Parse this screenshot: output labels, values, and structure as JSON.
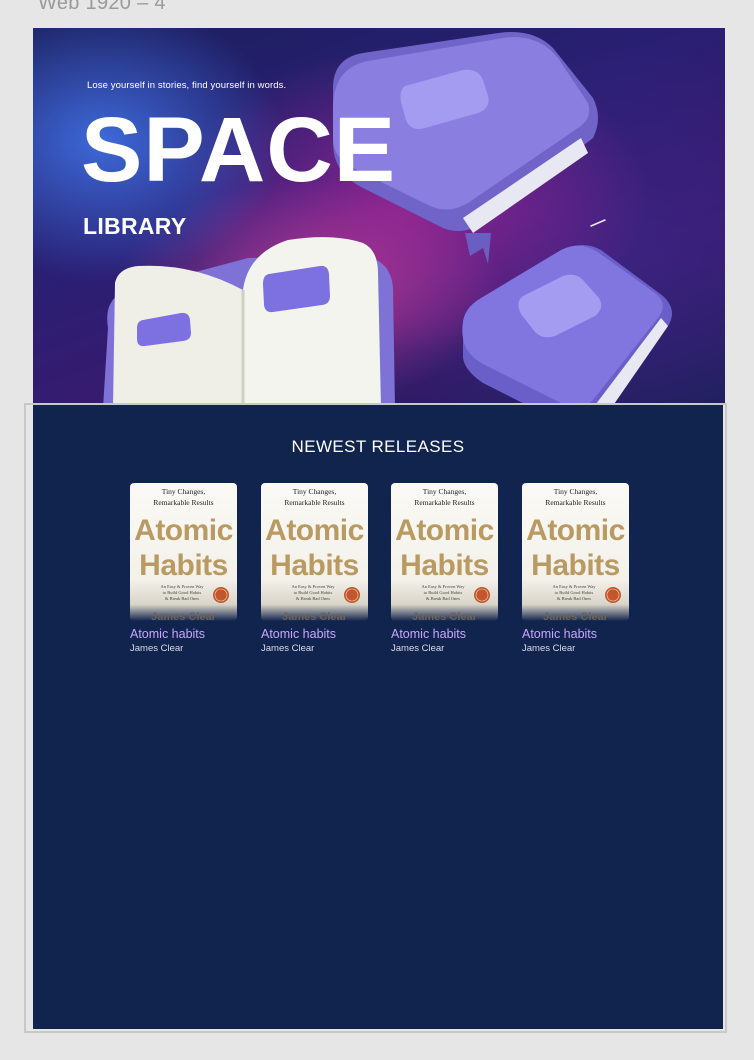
{
  "frame": {
    "label": "Web 1920 – 4"
  },
  "hero": {
    "tagline": "Lose yourself in stories, find yourself in words.",
    "title": "SPACE",
    "subtitle": "LIBRARY"
  },
  "releases": {
    "heading": "NEWEST RELEASES",
    "books": [
      {
        "title": "Atomic habits",
        "author": "James Clear",
        "cover": {
          "tagline_1": "Tiny Changes,",
          "tagline_2": "Remarkable Results",
          "word_1": "Atomic",
          "word_2": "Habits",
          "blurb_1": "An Easy & Proven Way",
          "blurb_2": "to Build Good Habits",
          "blurb_3": "& Break Bad Ones",
          "author": "James Clear"
        }
      },
      {
        "title": "Atomic habits",
        "author": "James Clear",
        "cover": {
          "tagline_1": "Tiny Changes,",
          "tagline_2": "Remarkable Results",
          "word_1": "Atomic",
          "word_2": "Habits",
          "blurb_1": "An Easy & Proven Way",
          "blurb_2": "to Build Good Habits",
          "blurb_3": "& Break Bad Ones",
          "author": "James Clear"
        }
      },
      {
        "title": "Atomic habits",
        "author": "James Clear",
        "cover": {
          "tagline_1": "Tiny Changes,",
          "tagline_2": "Remarkable Results",
          "word_1": "Atomic",
          "word_2": "Habits",
          "blurb_1": "An Easy & Proven Way",
          "blurb_2": "to Build Good Habits",
          "blurb_3": "& Break Bad Ones",
          "author": "James Clear"
        }
      },
      {
        "title": "Atomic habits",
        "author": "James Clear",
        "cover": {
          "tagline_1": "Tiny Changes,",
          "tagline_2": "Remarkable Results",
          "word_1": "Atomic",
          "word_2": "Habits",
          "blurb_1": "An Easy & Proven Way",
          "blurb_2": "to Build Good Habits",
          "blurb_3": "& Break Bad Ones",
          "author": "James Clear"
        }
      }
    ]
  },
  "colors": {
    "section_bg": "#11244d",
    "book_title": "#c8a6ff",
    "book_purple": "#7b6fe0",
    "cover_gold": "#b89a62"
  }
}
